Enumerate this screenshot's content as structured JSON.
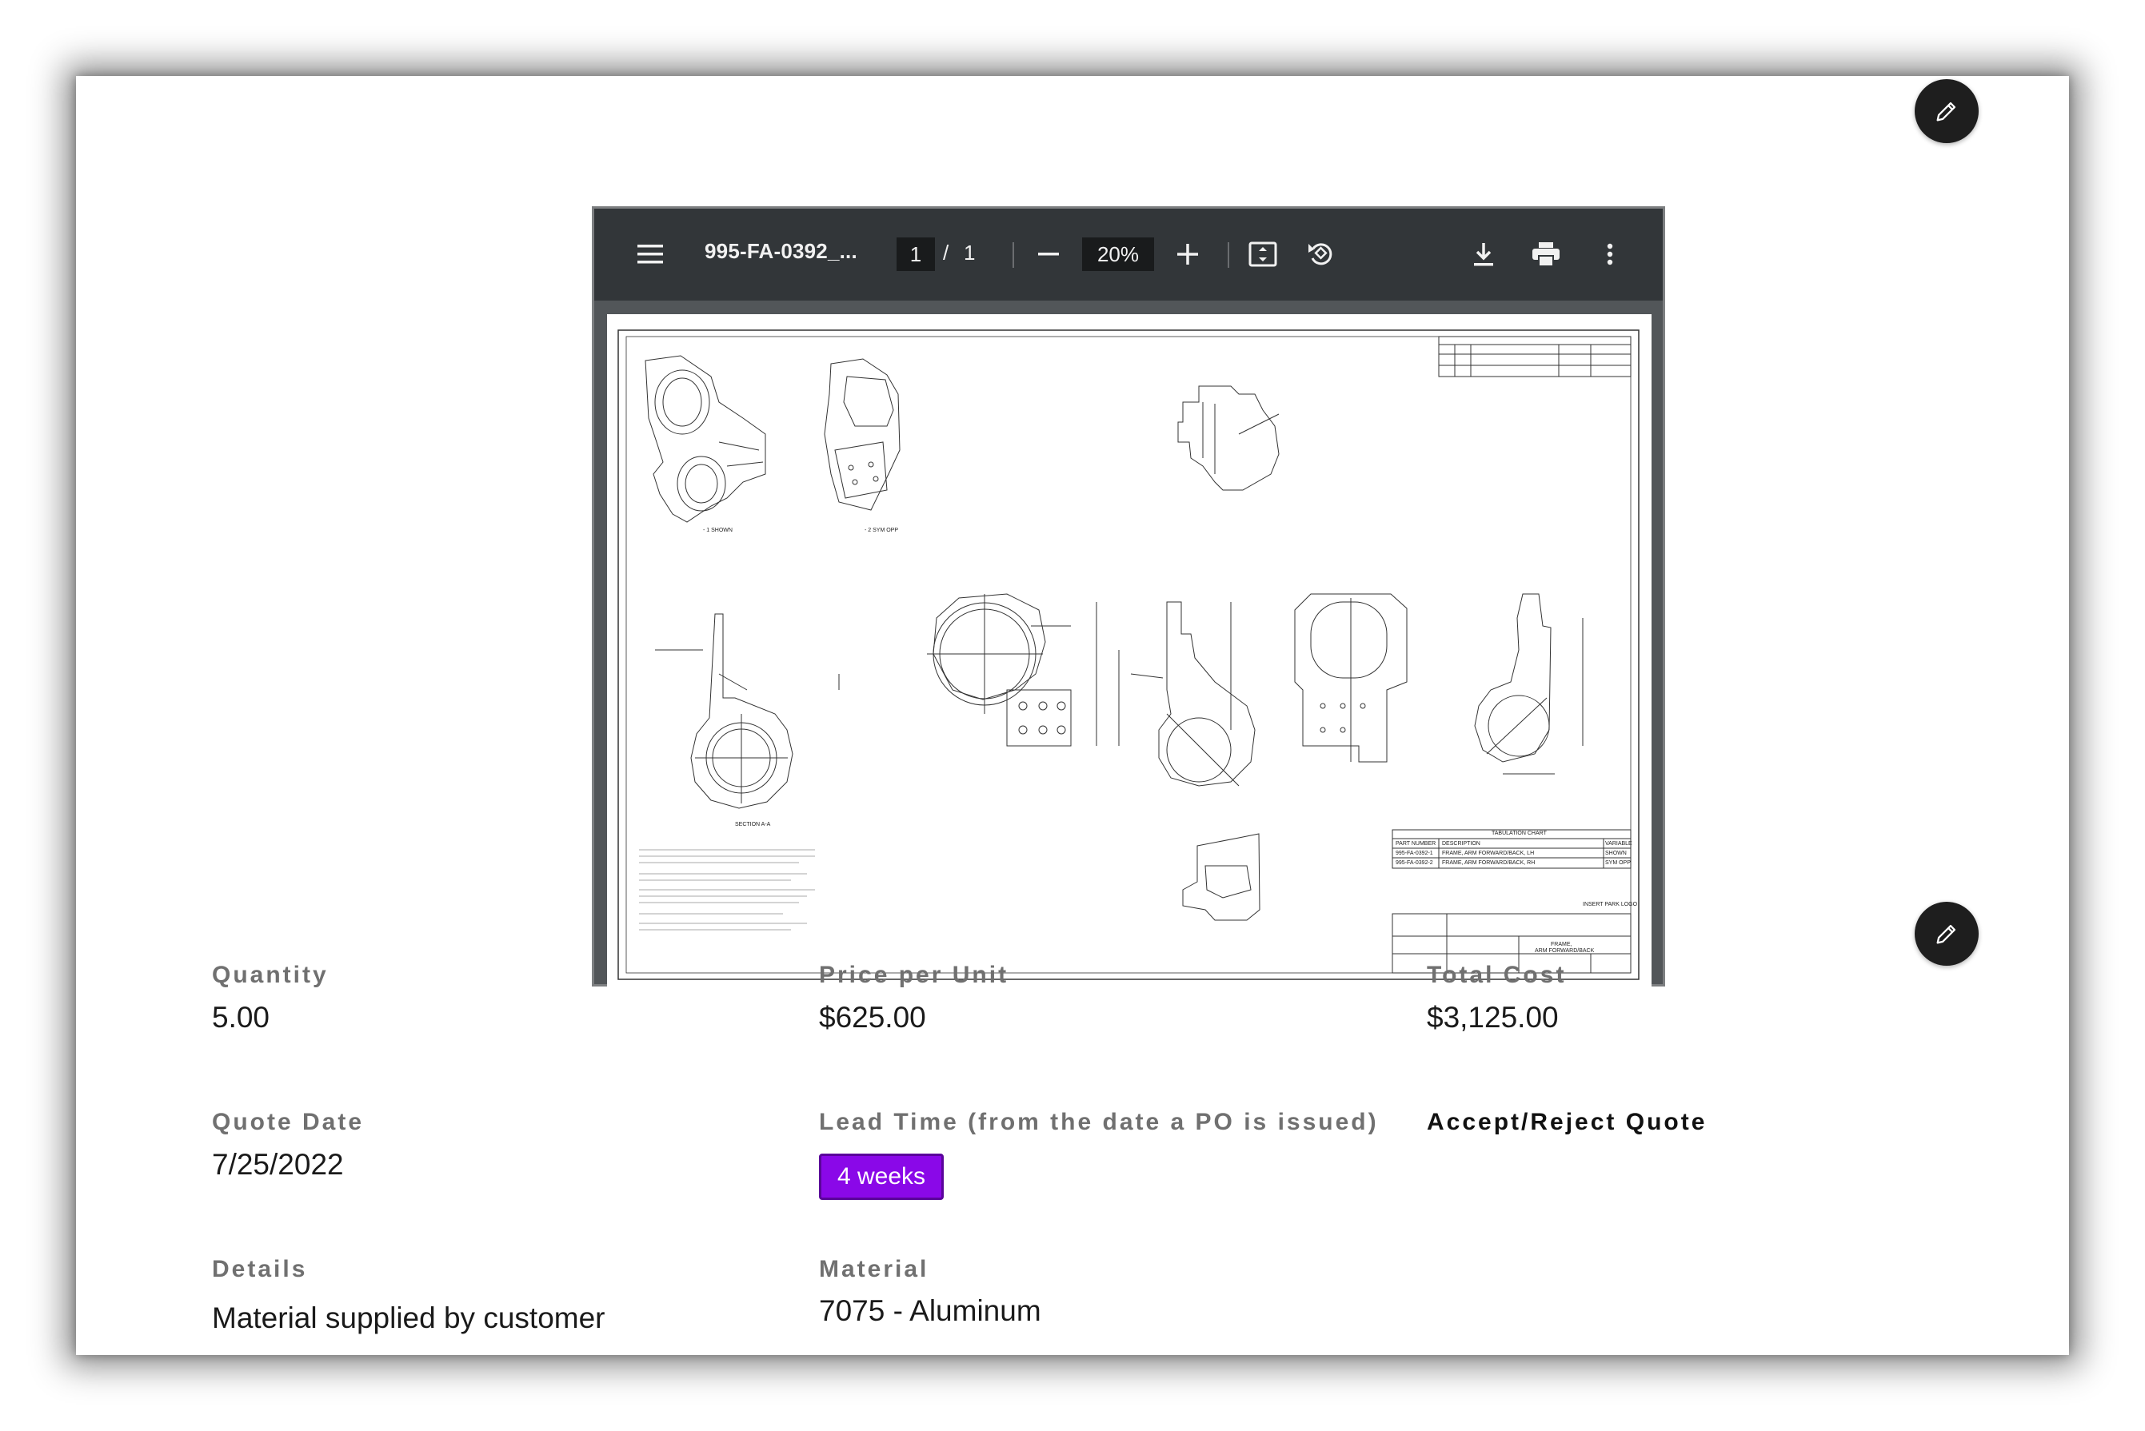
{
  "viewer": {
    "file_name": "995-FA-0392_...",
    "page_current": "1",
    "page_separator": "/",
    "page_total": "1",
    "zoom": "20%"
  },
  "icons": {
    "menu": "menu-icon",
    "zoom_out": "minus-icon",
    "zoom_in": "plus-icon",
    "fit": "fit-page-icon",
    "rotate": "rotate-icon",
    "download": "download-icon",
    "print": "print-icon",
    "more": "more-vertical-icon",
    "edit": "pencil-icon"
  },
  "drawing": {
    "tab_chart_title": "TABULATION CHART",
    "tab_headers": [
      "PART NUMBER",
      "DESCRIPTION",
      "VARIABLE"
    ],
    "tab_rows": [
      [
        "995-FA-0392-1",
        "FRAME, ARM FORWARD/BACK, LH",
        "SHOWN"
      ],
      [
        "995-FA-0392-2",
        "FRAME, ARM FORWARD/BACK, RH",
        "SYM OPP"
      ]
    ],
    "title_line1": "FRAME,",
    "title_line2": "ARM FORWARD/BACK",
    "logo_text": "INSERT PARK LOGO",
    "shown_label": "- 1 SHOWN",
    "sym_label": "- 2 SYM OPP",
    "section_label": "SECTION A-A"
  },
  "fields": {
    "quantity": {
      "label": "Quantity",
      "value": "5.00"
    },
    "price_per_unit": {
      "label": "Price per Unit",
      "value": "$625.00"
    },
    "total_cost": {
      "label": "Total Cost",
      "value": "$3,125.00"
    },
    "quote_date": {
      "label": "Quote Date",
      "value": "7/25/2022"
    },
    "lead_time": {
      "label": "Lead Time (from the date a PO is issued)",
      "value": "4 weeks"
    },
    "accept_reject": {
      "label": "Accept/Reject Quote"
    },
    "details": {
      "label": "Details",
      "value": "Material supplied by customer"
    },
    "material": {
      "label": "Material",
      "value": "7075 - Aluminum"
    }
  },
  "colors": {
    "badge": "#8a08e8",
    "toolbar": "#323639",
    "edit_button": "#1e1e1e"
  }
}
